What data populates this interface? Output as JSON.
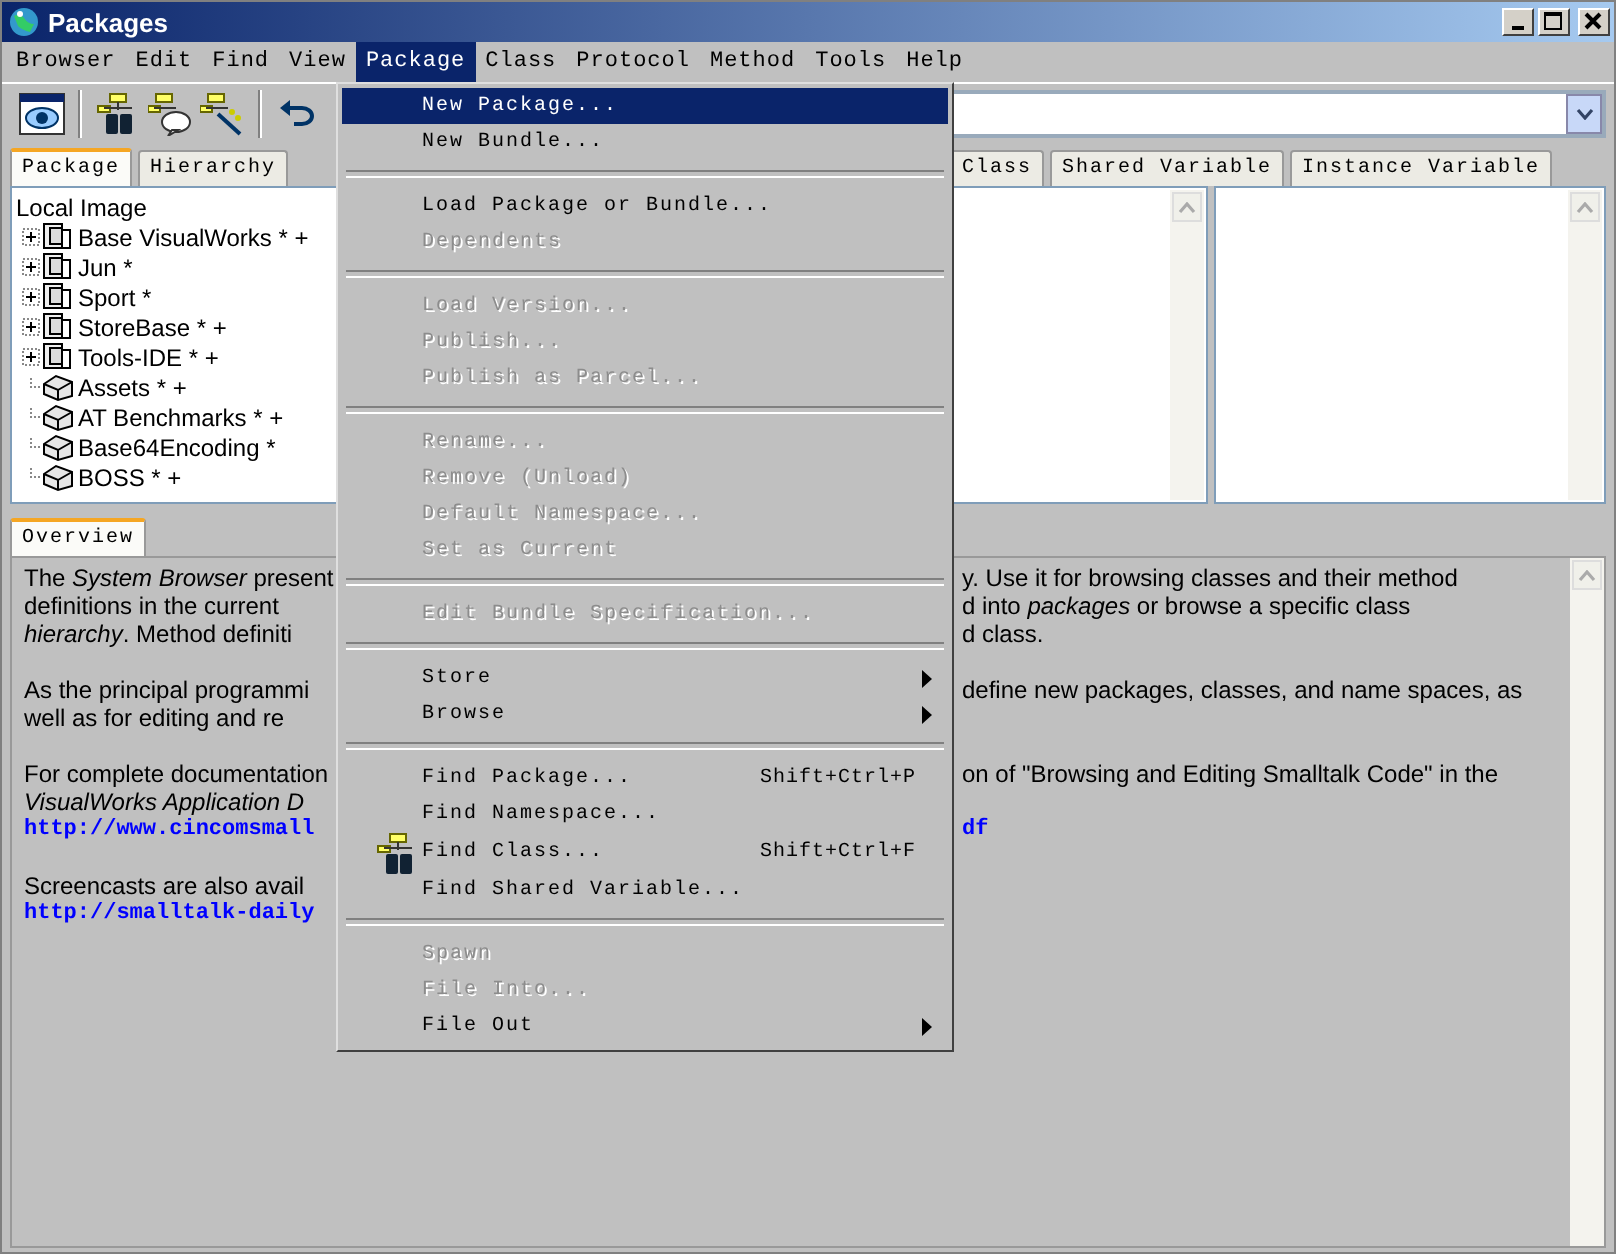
{
  "window": {
    "title": "Packages"
  },
  "menubar": [
    {
      "label": "Browser",
      "selected": false
    },
    {
      "label": "Edit",
      "selected": false
    },
    {
      "label": "Find",
      "selected": false
    },
    {
      "label": "View",
      "selected": false
    },
    {
      "label": "Package",
      "selected": true
    },
    {
      "label": "Class",
      "selected": false
    },
    {
      "label": "Protocol",
      "selected": false
    },
    {
      "label": "Method",
      "selected": false
    },
    {
      "label": "Tools",
      "selected": false
    },
    {
      "label": "Help",
      "selected": false
    }
  ],
  "toolbar": [
    {
      "kind": "browser"
    },
    {
      "kind": "separator"
    },
    {
      "kind": "find-class"
    },
    {
      "kind": "class-comment"
    },
    {
      "kind": "class-wand"
    },
    {
      "kind": "separator"
    },
    {
      "kind": "undo"
    }
  ],
  "left_tabs": [
    {
      "label": "Package",
      "selected": true
    },
    {
      "label": "Hierarchy",
      "selected": false
    }
  ],
  "right_tabs": [
    {
      "label": "Class",
      "selected": false
    },
    {
      "label": "Shared Variable",
      "selected": false
    },
    {
      "label": "Instance Variable",
      "selected": false
    }
  ],
  "tree": {
    "root": "Local Image",
    "children": [
      {
        "label": "Base VisualWorks * +",
        "kind": "bundle",
        "expanded": false
      },
      {
        "label": "Jun *",
        "kind": "bundle",
        "expanded": false
      },
      {
        "label": "Sport *",
        "kind": "bundle",
        "expanded": false
      },
      {
        "label": "StoreBase * +",
        "kind": "bundle",
        "expanded": false
      },
      {
        "label": "Tools-IDE * +",
        "kind": "bundle",
        "expanded": false
      },
      {
        "label": "Assets * +",
        "kind": "package"
      },
      {
        "label": "AT Benchmarks * +",
        "kind": "package"
      },
      {
        "label": "Base64Encoding *",
        "kind": "package"
      },
      {
        "label": "BOSS * +",
        "kind": "package"
      }
    ]
  },
  "overview": {
    "tab": {
      "label": "Overview",
      "selected": true
    },
    "lines": [
      {
        "kind": "text",
        "left": "The *System Browser* present",
        "right": "y. Use it for browsing classes and their method"
      },
      {
        "kind": "text",
        "left": "definitions in the current",
        "right": "d into *packages* or browse a specific class"
      },
      {
        "kind": "text",
        "left": "*hierarchy*. Method definiti",
        "right": "d class."
      },
      {
        "kind": "blank"
      },
      {
        "kind": "text",
        "left": "As the principal programmi",
        "right": "define new packages, classes, and name spaces, as"
      },
      {
        "kind": "text",
        "left": "well as for editing and re"
      },
      {
        "kind": "blank"
      },
      {
        "kind": "text",
        "left": "For complete documentation",
        "right": "on of \"Browsing and Editing Smalltalk Code\" in the"
      },
      {
        "kind": "text",
        "left": "*VisualWorks Application D*"
      },
      {
        "kind": "link",
        "left": "http://www.cincomsmall",
        "right": "df"
      },
      {
        "kind": "blank"
      },
      {
        "kind": "text",
        "left": "Screencasts are also avail"
      },
      {
        "kind": "link",
        "left": "http://smalltalk-daily"
      }
    ]
  },
  "menu": {
    "items": [
      {
        "kind": "item",
        "label": "New Package...",
        "selected": true,
        "disabled": false
      },
      {
        "kind": "item",
        "label": "New Bundle...",
        "selected": false,
        "disabled": false
      },
      {
        "kind": "separator"
      },
      {
        "kind": "item",
        "label": "Load Package or Bundle...",
        "selected": false,
        "disabled": false
      },
      {
        "kind": "item",
        "label": "Dependents",
        "selected": false,
        "disabled": true
      },
      {
        "kind": "separator"
      },
      {
        "kind": "item",
        "label": "Load Version...",
        "selected": false,
        "disabled": true
      },
      {
        "kind": "item",
        "label": "Publish...",
        "selected": false,
        "disabled": true
      },
      {
        "kind": "item",
        "label": "Publish as Parcel...",
        "selected": false,
        "disabled": true
      },
      {
        "kind": "separator"
      },
      {
        "kind": "item",
        "label": "Rename...",
        "selected": false,
        "disabled": true
      },
      {
        "kind": "item",
        "label": "Remove (Unload)",
        "selected": false,
        "disabled": true
      },
      {
        "kind": "item",
        "label": "Default Namespace...",
        "selected": false,
        "disabled": true
      },
      {
        "kind": "item",
        "label": "Set as Current",
        "selected": false,
        "disabled": true
      },
      {
        "kind": "separator"
      },
      {
        "kind": "item",
        "label": "Edit Bundle Specification...",
        "selected": false,
        "disabled": true
      },
      {
        "kind": "separator"
      },
      {
        "kind": "submenu",
        "label": "Store",
        "selected": false,
        "disabled": false
      },
      {
        "kind": "submenu",
        "label": "Browse",
        "selected": false,
        "disabled": false
      },
      {
        "kind": "separator"
      },
      {
        "kind": "item",
        "label": "Find Package...",
        "shortcut": "Shift+Ctrl+P",
        "selected": false,
        "disabled": false
      },
      {
        "kind": "item",
        "label": "Find Namespace...",
        "selected": false,
        "disabled": false
      },
      {
        "kind": "icon-item",
        "label": "Find Class...",
        "shortcut": "Shift+Ctrl+F",
        "selected": false,
        "disabled": false
      },
      {
        "kind": "item",
        "label": "Find Shared Variable...",
        "selected": false,
        "disabled": false
      },
      {
        "kind": "separator"
      },
      {
        "kind": "item",
        "label": "Spawn",
        "selected": false,
        "disabled": true
      },
      {
        "kind": "item",
        "label": "File Into...",
        "selected": false,
        "disabled": true
      },
      {
        "kind": "submenu",
        "label": "File Out",
        "selected": false,
        "disabled": false
      }
    ]
  }
}
